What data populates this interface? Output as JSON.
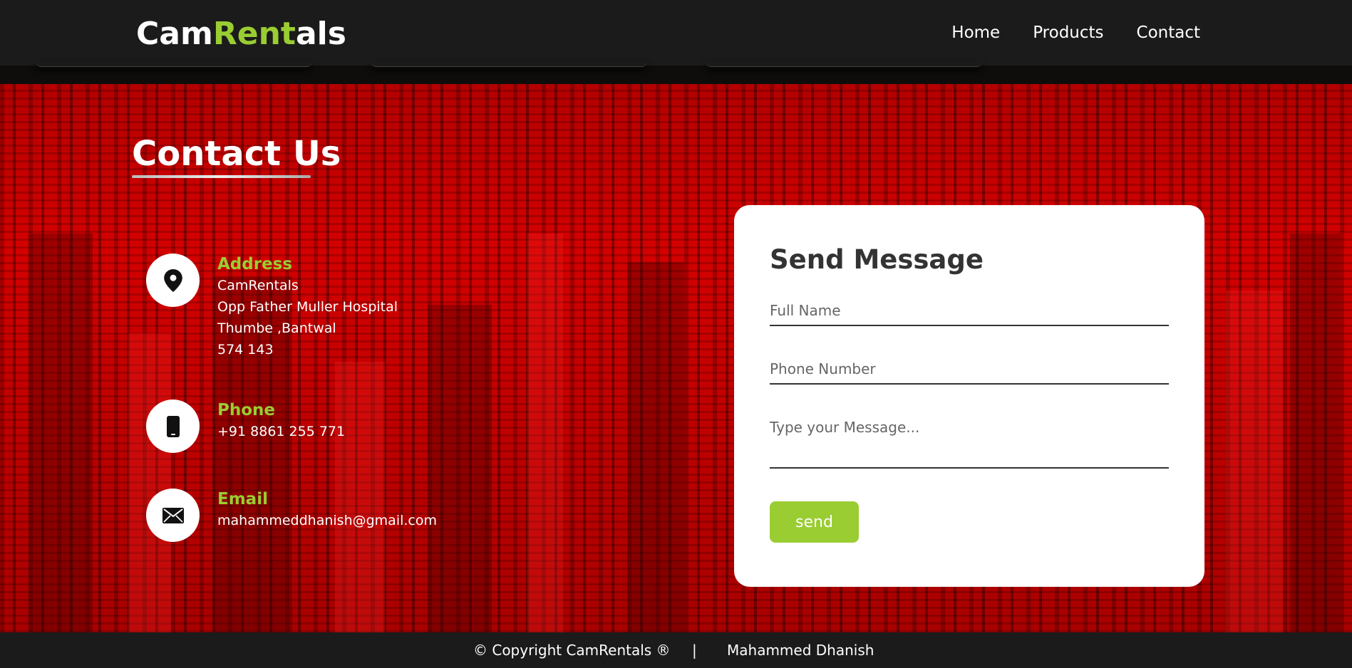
{
  "brand": {
    "part1": "Cam",
    "part2": "Rent",
    "part3": "als"
  },
  "nav": {
    "home": "Home",
    "products": "Products",
    "contact": "Contact"
  },
  "section_title": "Contact Us",
  "address": {
    "label": "Address",
    "lines": [
      "CamRentals",
      "Opp Father Muller Hospital",
      "Thumbe ,Bantwal",
      "574 143"
    ]
  },
  "phone": {
    "label": "Phone",
    "value": "+91 8861 255 771"
  },
  "email": {
    "label": "Email",
    "value": "mahammeddhanish@gmail.com"
  },
  "form": {
    "title": "Send Message",
    "name_placeholder": "Full Name",
    "phone_placeholder": "Phone Number",
    "message_placeholder": "Type your Message...",
    "send_label": "send"
  },
  "footer": {
    "copyright": "© Copyright CamRentals ®",
    "separator": "|",
    "author": "Mahammed Dhanish"
  },
  "colors": {
    "accent": "#9acd32",
    "header_bg": "#1b1b1b",
    "hero_red": "#c00000"
  },
  "icons": {
    "address": "location-pin-icon",
    "phone": "mobile-phone-icon",
    "email": "envelope-icon"
  }
}
